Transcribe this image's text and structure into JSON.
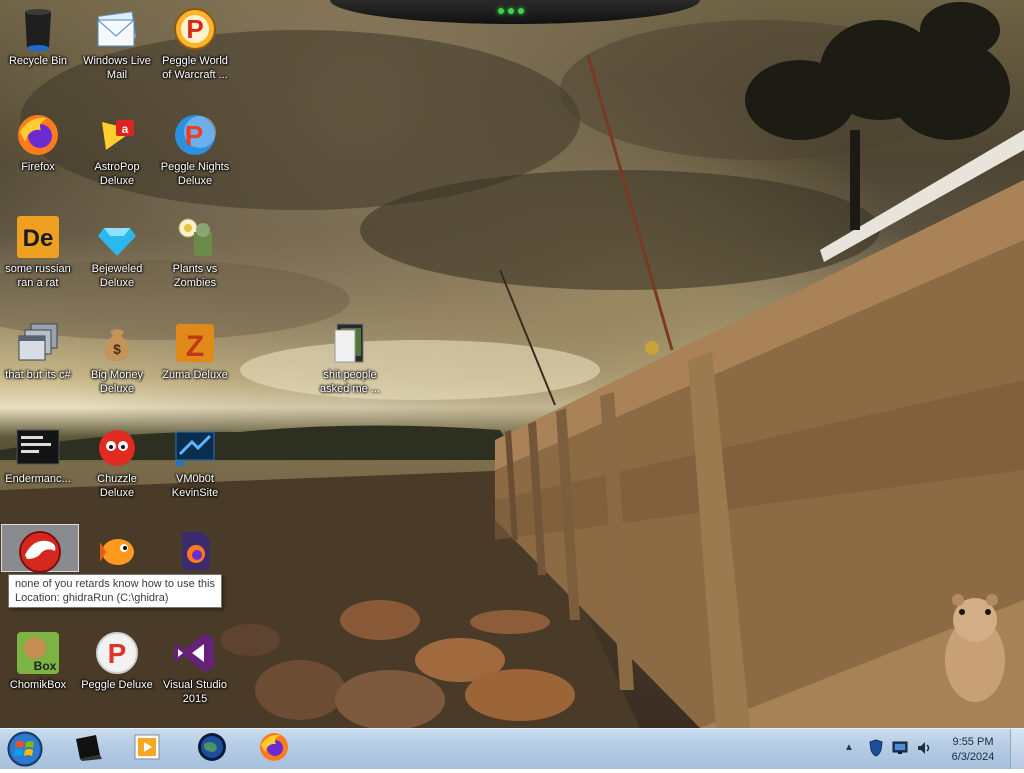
{
  "desktop": {
    "icons": [
      {
        "label": "Recycle Bin",
        "icon": "recycle-bin-icon"
      },
      {
        "label": "Windows Live Mail",
        "icon": "mail-icon"
      },
      {
        "label": "Peggle World of Warcraft ...",
        "icon": "peggle-icon"
      },
      {
        "label": "Firefox",
        "icon": "firefox-icon"
      },
      {
        "label": "AstroPop Deluxe",
        "icon": "astropop-icon"
      },
      {
        "label": "Peggle Nights Deluxe",
        "icon": "peggle-nights-icon"
      },
      {
        "label": "some russian ran a rat",
        "icon": "app-de-icon"
      },
      {
        "label": "Bejeweled Deluxe",
        "icon": "gem-icon"
      },
      {
        "label": "Plants vs Zombies",
        "icon": "plant-icon"
      },
      {
        "label": "that but its c#",
        "icon": "windows-stack-icon"
      },
      {
        "label": "Big Money Deluxe",
        "icon": "money-bag-icon"
      },
      {
        "label": "Zuma Deluxe",
        "icon": "zuma-icon"
      },
      {
        "label": "shit people asked me ...",
        "icon": "folder-icon"
      },
      {
        "label": "Endermanc...",
        "icon": "console-icon"
      },
      {
        "label": "Chuzzle Deluxe",
        "icon": "chuzzle-icon"
      },
      {
        "label": "VM0b0t KevinSite",
        "icon": "vm-icon"
      },
      {
        "label": "",
        "icon": "ghidra-icon"
      },
      {
        "label": "",
        "icon": "fish-icon"
      },
      {
        "label": "",
        "icon": "firefox-file-icon"
      },
      {
        "label": "ChomikBox",
        "icon": "chomikbox-icon"
      },
      {
        "label": "Peggle Deluxe",
        "icon": "peggle-deluxe-icon"
      },
      {
        "label": "Visual Studio 2015",
        "icon": "visual-studio-icon"
      }
    ]
  },
  "tooltip": {
    "line1": "none of you retards know how to use this",
    "line2": "Location: ghidraRun (C:\\ghidra)"
  },
  "taskbar": {
    "pinned": [
      "file-explorer-icon",
      "media-player-icon",
      "globe-icon",
      "firefox-icon"
    ],
    "tray": [
      "show-hidden-icons-icon",
      "shield-icon",
      "network-icon",
      "volume-icon"
    ],
    "time": "9:55 PM",
    "date": "6/3/2024"
  },
  "colors": {
    "taskbar": "#b4cbe3",
    "tooltip_border": "#767676",
    "led": "#3dd34a"
  }
}
